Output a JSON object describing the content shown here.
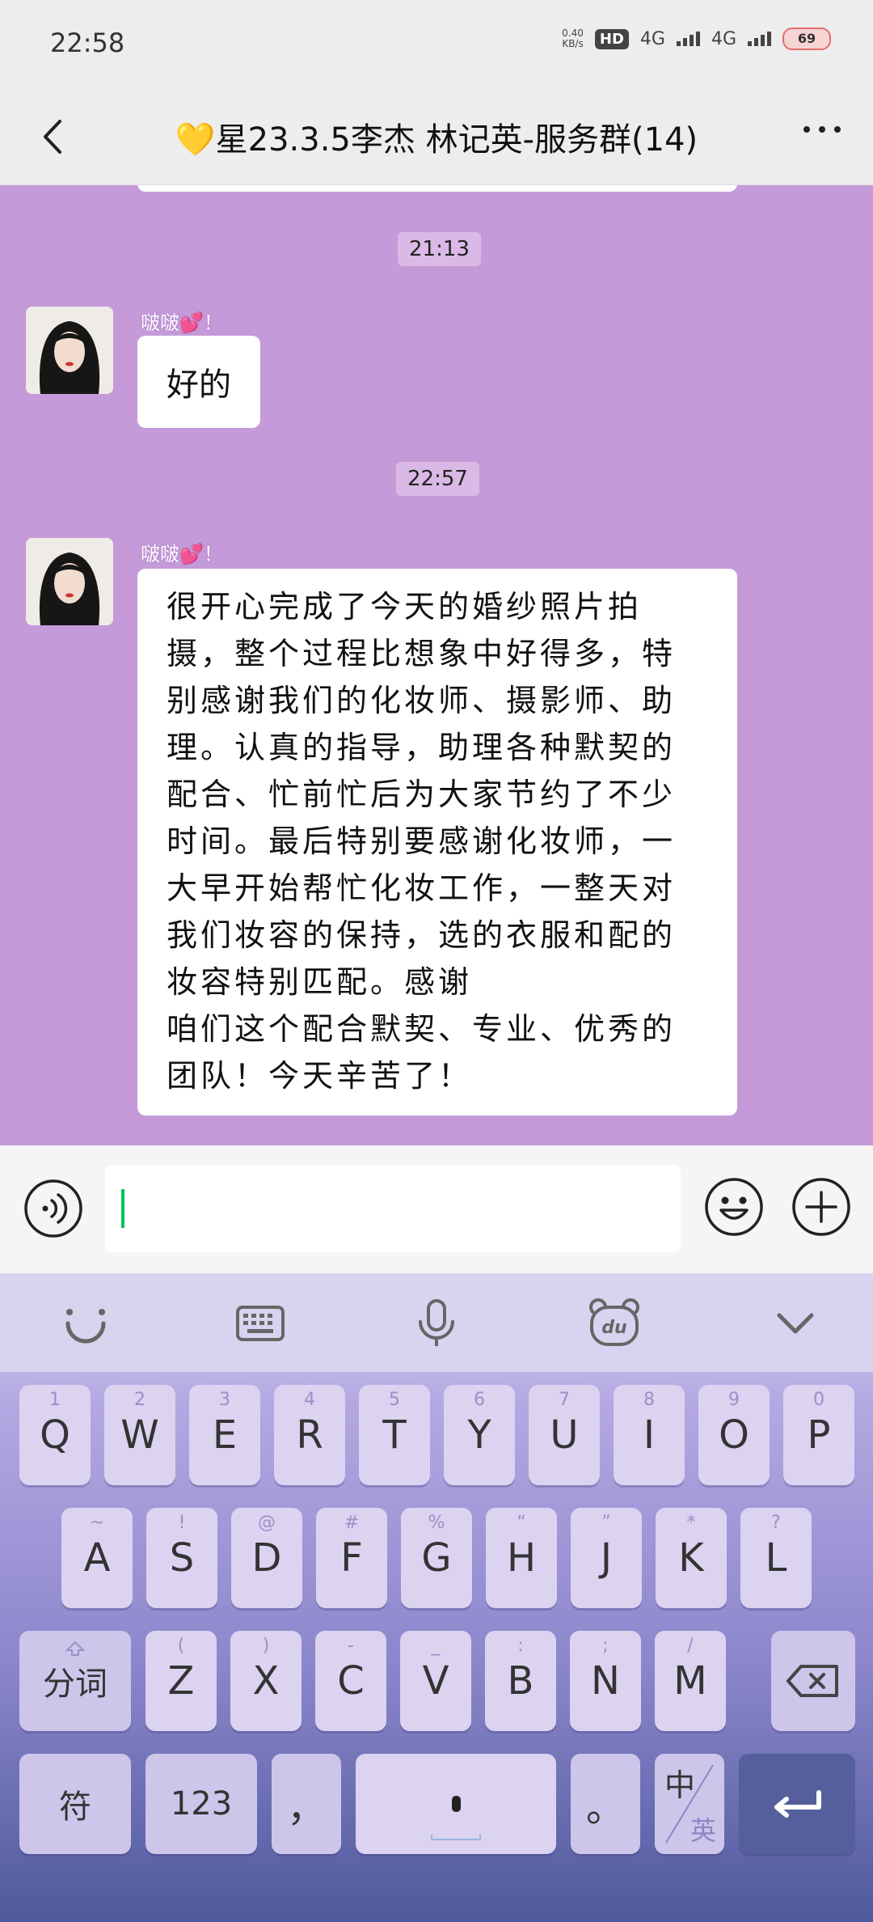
{
  "status_bar": {
    "time": "22:58",
    "net_speed_top": "0.40",
    "net_speed_bottom": "KB/s",
    "hd": "HD",
    "network1": "4G",
    "network2": "4G",
    "battery": "69"
  },
  "header": {
    "title": "💛星23.3.5李杰 林记英-服务群(14)"
  },
  "chat": {
    "timestamp1": "21:13",
    "timestamp2": "22:57",
    "sender_name": "啵啵💕！",
    "msg1": "好的",
    "msg2_lines": [
      "很开心完成了今天的婚纱照片拍",
      "摄，整个过程比想象中好得多，特",
      "别感谢我们的化妆师、摄影师、助",
      "理。认真的指导，助理各种默契的",
      "配合、忙前忙后为大家节约了不少",
      "时间。最后特别要感谢化妆师，一",
      "大早开始帮忙化妆工作，一整天对",
      "我们妆容的保持，选的衣服和配的",
      "妆容特别匹配。感谢",
      "咱们这个配合默契、专业、优秀的",
      "团队！今天辛苦了！"
    ]
  },
  "keyboard": {
    "row1": [
      {
        "k": "Q",
        "s": "1"
      },
      {
        "k": "W",
        "s": "2"
      },
      {
        "k": "E",
        "s": "3"
      },
      {
        "k": "R",
        "s": "4"
      },
      {
        "k": "T",
        "s": "5"
      },
      {
        "k": "Y",
        "s": "6"
      },
      {
        "k": "U",
        "s": "7"
      },
      {
        "k": "I",
        "s": "8"
      },
      {
        "k": "O",
        "s": "9"
      },
      {
        "k": "P",
        "s": "0"
      }
    ],
    "row2": [
      {
        "k": "A",
        "s": "~"
      },
      {
        "k": "S",
        "s": "!"
      },
      {
        "k": "D",
        "s": "@"
      },
      {
        "k": "F",
        "s": "#"
      },
      {
        "k": "G",
        "s": "%"
      },
      {
        "k": "H",
        "s": "“"
      },
      {
        "k": "J",
        "s": "”"
      },
      {
        "k": "K",
        "s": "*"
      },
      {
        "k": "L",
        "s": "?"
      }
    ],
    "row3": [
      {
        "k": "Z",
        "s": "("
      },
      {
        "k": "X",
        "s": ")"
      },
      {
        "k": "C",
        "s": "-"
      },
      {
        "k": "V",
        "s": "_"
      },
      {
        "k": "B",
        "s": ":"
      },
      {
        "k": "N",
        "s": ";"
      },
      {
        "k": "M",
        "s": "/"
      }
    ],
    "fenci": "分词",
    "fu": "符",
    "num": "123",
    "comma": "，",
    "period": "。",
    "zh": "中",
    "en": "英"
  }
}
